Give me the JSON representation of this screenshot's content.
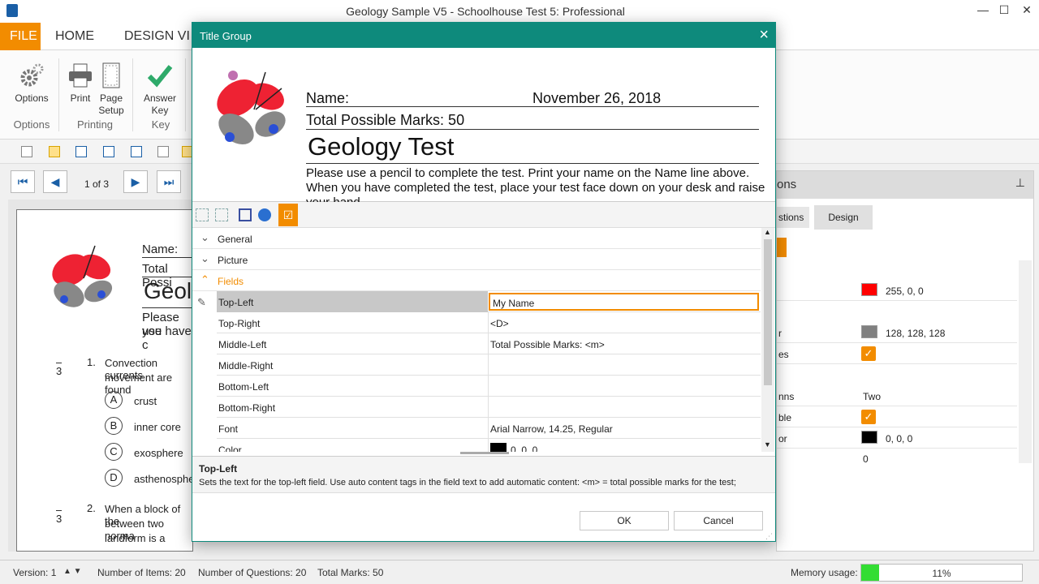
{
  "window": {
    "title": "Geology Sample V5 - Schoolhouse Test 5: Professional"
  },
  "ribbon": {
    "tabs": [
      "FILE",
      "HOME",
      "DESIGN VI"
    ],
    "buttons": {
      "options": "Options",
      "print": "Print",
      "page_setup_1": "Page",
      "page_setup_2": "Setup",
      "answer_key_1": "Answer",
      "answer_key_2": "Key"
    },
    "groups": {
      "options": "Options",
      "printing": "Printing",
      "key": "Key"
    }
  },
  "nav": {
    "page_indicator": "1 of 3"
  },
  "document": {
    "name_label": "Name:",
    "total_label": "Total Possi",
    "title_fragment": "Geol",
    "instr_1": "Please use",
    "instr_2": "you have c",
    "q1": {
      "marks": "3",
      "number": "1.",
      "text_1": "Convection currents",
      "text_2": "movement are found",
      "choices": [
        {
          "letter": "A",
          "text": "crust"
        },
        {
          "letter": "B",
          "text": "inner core"
        },
        {
          "letter": "C",
          "text": "exosphere"
        },
        {
          "letter": "D",
          "text": "asthenospher"
        }
      ]
    },
    "q2": {
      "marks": "3",
      "number": "2.",
      "text_1": "When a block of the",
      "text_2": "between two norma",
      "text_3": "landform is a"
    }
  },
  "right_panel": {
    "header": "ons",
    "tabs": [
      "stions",
      "Design"
    ],
    "rows": [
      {
        "label": "",
        "value": "255, 0, 0",
        "swatch": "#ff0000"
      },
      {
        "label": "r",
        "value": "128, 128, 128",
        "swatch": "#808080"
      },
      {
        "label": "es",
        "value": "",
        "check": true
      },
      {
        "label": "nns",
        "value": "Two"
      },
      {
        "label": "ble",
        "value": "",
        "check": true
      },
      {
        "label": "or",
        "value": "0, 0, 0",
        "swatch": "#000000"
      },
      {
        "label": "",
        "value": "0"
      }
    ]
  },
  "status": {
    "version": "Version: 1",
    "items": "Number of Items: 20",
    "questions": "Number of Questions: 20",
    "marks": "Total Marks: 50",
    "memory_label": "Memory usage:",
    "memory_value": "11%",
    "memory_fraction": 0.11
  },
  "dialog": {
    "title": "Title Group",
    "preview": {
      "name": "Name:",
      "date": "November 26, 2018",
      "total": "Total Possible Marks: 50",
      "title": "Geology Test",
      "instructions": "Please use a pencil to complete the test. Print your name on the Name line above. When you have completed the test, place your test face down on your desk and raise your hand."
    },
    "categories": {
      "general": "General",
      "picture": "Picture",
      "fields": "Fields"
    },
    "properties": [
      {
        "key": "Top-Left",
        "value": "My Name"
      },
      {
        "key": "Top-Right",
        "value": "<D>"
      },
      {
        "key": "Middle-Left",
        "value": "Total Possible Marks: <m>"
      },
      {
        "key": "Middle-Right",
        "value": ""
      },
      {
        "key": "Bottom-Left",
        "value": ""
      },
      {
        "key": "Bottom-Right",
        "value": ""
      },
      {
        "key": "Font",
        "value": "Arial Narrow, 14.25, Regular"
      },
      {
        "key": "Color",
        "value": "0, 0, 0"
      }
    ],
    "description": {
      "title": "Top-Left",
      "text": "Sets the text for the top-left field. Use auto content tags in the field text to add automatic content: <m> = total possible marks for the test;"
    },
    "ok": "OK",
    "cancel": "Cancel"
  },
  "colors": {
    "accent": "#f28c00",
    "dialog_title": "#0e8a7c",
    "nav_blue": "#1a5fa6"
  }
}
